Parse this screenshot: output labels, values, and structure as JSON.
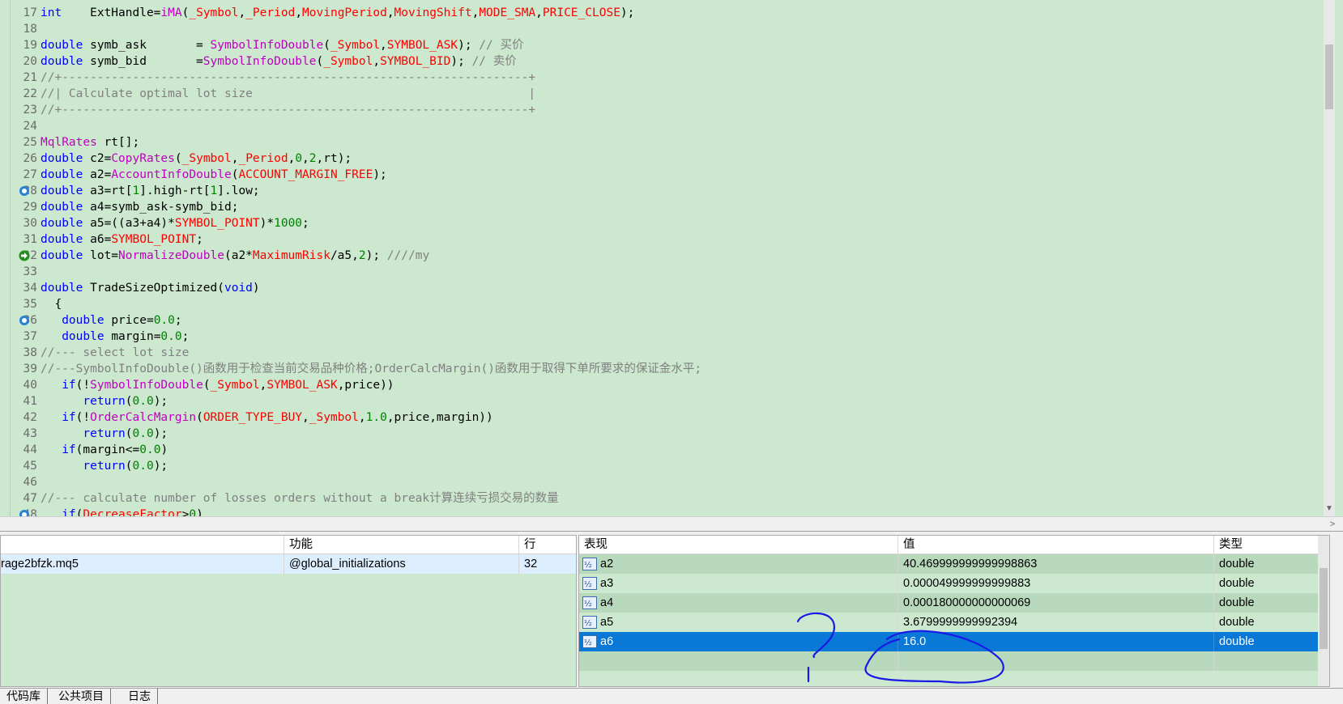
{
  "editor": {
    "lines": [
      {
        "n": "17",
        "marker": "",
        "tokens": [
          [
            "kw",
            "int    "
          ],
          [
            "id",
            "ExtHandle="
          ],
          [
            "fn",
            "iMA"
          ],
          [
            "id",
            "("
          ],
          [
            "cn",
            "_Symbol"
          ],
          [
            "id",
            ","
          ],
          [
            "cn",
            "_Period"
          ],
          [
            "id",
            ","
          ],
          [
            "cn",
            "MovingPeriod"
          ],
          [
            "id",
            ","
          ],
          [
            "cn",
            "MovingShift"
          ],
          [
            "id",
            ","
          ],
          [
            "cn",
            "MODE_SMA"
          ],
          [
            "id",
            ","
          ],
          [
            "cn",
            "PRICE_CLOSE"
          ],
          [
            "id",
            ");"
          ]
        ]
      },
      {
        "n": "18",
        "marker": "",
        "tokens": []
      },
      {
        "n": "19",
        "marker": "",
        "tokens": [
          [
            "kw",
            "double "
          ],
          [
            "id",
            "symb_ask       = "
          ],
          [
            "fn",
            "SymbolInfoDouble"
          ],
          [
            "id",
            "("
          ],
          [
            "cn",
            "_Symbol"
          ],
          [
            "id",
            ","
          ],
          [
            "cn",
            "SYMBOL_ASK"
          ],
          [
            "id",
            "); "
          ],
          [
            "cm",
            "// 买价"
          ]
        ]
      },
      {
        "n": "20",
        "marker": "",
        "tokens": [
          [
            "kw",
            "double "
          ],
          [
            "id",
            "symb_bid       ="
          ],
          [
            "fn",
            "SymbolInfoDouble"
          ],
          [
            "id",
            "("
          ],
          [
            "cn",
            "_Symbol"
          ],
          [
            "id",
            ","
          ],
          [
            "cn",
            "SYMBOL_BID"
          ],
          [
            "id",
            "); "
          ],
          [
            "cm",
            "// 卖价"
          ]
        ]
      },
      {
        "n": "21",
        "marker": "",
        "tokens": [
          [
            "cm",
            "//+------------------------------------------------------------------+"
          ]
        ]
      },
      {
        "n": "22",
        "marker": "",
        "tokens": [
          [
            "cm",
            "//| Calculate optimal lot size                                       |"
          ]
        ]
      },
      {
        "n": "23",
        "marker": "",
        "tokens": [
          [
            "cm",
            "//+------------------------------------------------------------------+"
          ]
        ]
      },
      {
        "n": "24",
        "marker": "",
        "tokens": []
      },
      {
        "n": "25",
        "marker": "",
        "tokens": [
          [
            "fn",
            "MqlRates"
          ],
          [
            "id",
            " rt[];"
          ]
        ]
      },
      {
        "n": "26",
        "marker": "",
        "tokens": [
          [
            "kw",
            "double "
          ],
          [
            "id",
            "c2="
          ],
          [
            "fn",
            "CopyRates"
          ],
          [
            "id",
            "("
          ],
          [
            "cn",
            "_Symbol"
          ],
          [
            "id",
            ","
          ],
          [
            "cn",
            "_Period"
          ],
          [
            "id",
            ","
          ],
          [
            "nm",
            "0"
          ],
          [
            "id",
            ","
          ],
          [
            "nm",
            "2"
          ],
          [
            "id",
            ",rt);"
          ]
        ]
      },
      {
        "n": "27",
        "marker": "",
        "tokens": [
          [
            "kw",
            "double "
          ],
          [
            "id",
            "a2="
          ],
          [
            "fn",
            "AccountInfoDouble"
          ],
          [
            "id",
            "("
          ],
          [
            "cn",
            "ACCOUNT_MARGIN_FREE"
          ],
          [
            "id",
            ");"
          ]
        ]
      },
      {
        "n": "28",
        "marker": "breakpoint",
        "tokens": [
          [
            "kw",
            "double "
          ],
          [
            "id",
            "a3=rt["
          ],
          [
            "nm",
            "1"
          ],
          [
            "id",
            "].high-rt["
          ],
          [
            "nm",
            "1"
          ],
          [
            "id",
            "].low;"
          ]
        ]
      },
      {
        "n": "29",
        "marker": "",
        "tokens": [
          [
            "kw",
            "double "
          ],
          [
            "id",
            "a4=symb_ask-symb_bid;"
          ]
        ]
      },
      {
        "n": "30",
        "marker": "",
        "tokens": [
          [
            "kw",
            "double "
          ],
          [
            "id",
            "a5=((a3+a4)*"
          ],
          [
            "cn",
            "SYMBOL_POINT"
          ],
          [
            "id",
            ")*"
          ],
          [
            "nm",
            "1000"
          ],
          [
            "id",
            ";"
          ]
        ]
      },
      {
        "n": "31",
        "marker": "",
        "tokens": [
          [
            "kw",
            "double "
          ],
          [
            "id",
            "a6="
          ],
          [
            "cn",
            "SYMBOL_POINT"
          ],
          [
            "id",
            ";"
          ]
        ]
      },
      {
        "n": "32",
        "marker": "current",
        "tokens": [
          [
            "kw",
            "double "
          ],
          [
            "id",
            "lot="
          ],
          [
            "fn",
            "NormalizeDouble"
          ],
          [
            "id",
            "(a2*"
          ],
          [
            "cn",
            "MaximumRisk"
          ],
          [
            "id",
            "/a5,"
          ],
          [
            "nm",
            "2"
          ],
          [
            "id",
            "); "
          ],
          [
            "cm",
            "////my"
          ]
        ]
      },
      {
        "n": "33",
        "marker": "",
        "tokens": []
      },
      {
        "n": "34",
        "marker": "",
        "tokens": [
          [
            "kw",
            "double "
          ],
          [
            "id",
            "TradeSizeOptimized("
          ],
          [
            "kw",
            "void"
          ],
          [
            "id",
            ")"
          ]
        ]
      },
      {
        "n": "35",
        "marker": "",
        "tokens": [
          [
            "id",
            "  {"
          ]
        ]
      },
      {
        "n": "36",
        "marker": "breakpoint",
        "tokens": [
          [
            "kw",
            "   double "
          ],
          [
            "id",
            "price="
          ],
          [
            "nm",
            "0.0"
          ],
          [
            "id",
            ";"
          ]
        ]
      },
      {
        "n": "37",
        "marker": "",
        "tokens": [
          [
            "kw",
            "   double "
          ],
          [
            "id",
            "margin="
          ],
          [
            "nm",
            "0.0"
          ],
          [
            "id",
            ";"
          ]
        ]
      },
      {
        "n": "38",
        "marker": "",
        "tokens": [
          [
            "cm",
            "//--- select lot size"
          ]
        ]
      },
      {
        "n": "39",
        "marker": "",
        "tokens": [
          [
            "cm",
            "//---SymbolInfoDouble()函数用于检查当前交易品种价格;OrderCalcMargin()函数用于取得下单所要求的保证金水平;"
          ]
        ]
      },
      {
        "n": "40",
        "marker": "",
        "tokens": [
          [
            "kw",
            "   if"
          ],
          [
            "id",
            "(!"
          ],
          [
            "fn",
            "SymbolInfoDouble"
          ],
          [
            "id",
            "("
          ],
          [
            "cn",
            "_Symbol"
          ],
          [
            "id",
            ","
          ],
          [
            "cn",
            "SYMBOL_ASK"
          ],
          [
            "id",
            ",price))"
          ]
        ]
      },
      {
        "n": "41",
        "marker": "",
        "tokens": [
          [
            "kw",
            "      return"
          ],
          [
            "id",
            "("
          ],
          [
            "nm",
            "0.0"
          ],
          [
            "id",
            ");"
          ]
        ]
      },
      {
        "n": "42",
        "marker": "",
        "tokens": [
          [
            "kw",
            "   if"
          ],
          [
            "id",
            "(!"
          ],
          [
            "fn",
            "OrderCalcMargin"
          ],
          [
            "id",
            "("
          ],
          [
            "cn",
            "ORDER_TYPE_BUY"
          ],
          [
            "id",
            ","
          ],
          [
            "cn",
            "_Symbol"
          ],
          [
            "id",
            ","
          ],
          [
            "nm",
            "1.0"
          ],
          [
            "id",
            ",price,margin))"
          ]
        ]
      },
      {
        "n": "43",
        "marker": "",
        "tokens": [
          [
            "kw",
            "      return"
          ],
          [
            "id",
            "("
          ],
          [
            "nm",
            "0.0"
          ],
          [
            "id",
            ");"
          ]
        ]
      },
      {
        "n": "44",
        "marker": "",
        "tokens": [
          [
            "kw",
            "   if"
          ],
          [
            "id",
            "(margin<="
          ],
          [
            "nm",
            "0.0"
          ],
          [
            "id",
            ")"
          ]
        ]
      },
      {
        "n": "45",
        "marker": "",
        "tokens": [
          [
            "kw",
            "      return"
          ],
          [
            "id",
            "("
          ],
          [
            "nm",
            "0.0"
          ],
          [
            "id",
            ");"
          ]
        ]
      },
      {
        "n": "46",
        "marker": "",
        "tokens": []
      },
      {
        "n": "47",
        "marker": "",
        "tokens": [
          [
            "cm",
            "//--- calculate number of losses orders without a break计算连续亏损交易的数量"
          ]
        ]
      },
      {
        "n": "48",
        "marker": "breakpoint",
        "tokens": [
          [
            "kw",
            "   if"
          ],
          [
            "id",
            "("
          ],
          [
            "cn",
            "DecreaseFactor"
          ],
          [
            "id",
            ">"
          ],
          [
            "nm",
            "0"
          ],
          [
            "id",
            ")"
          ]
        ]
      }
    ]
  },
  "callstack": {
    "headers": [
      "",
      "功能",
      "行"
    ],
    "rows": [
      {
        "file": "rage2bfzk.mq5",
        "function": "@global_initializations",
        "line": "32"
      }
    ]
  },
  "watch": {
    "headers": [
      "表现",
      "值",
      "类型"
    ],
    "rows": [
      {
        "name": "a2",
        "value": "40.469999999999998863",
        "type": "double"
      },
      {
        "name": "a3",
        "value": "0.000049999999999883",
        "type": "double"
      },
      {
        "name": "a4",
        "value": "0.000180000000000069",
        "type": "double"
      },
      {
        "name": "a5",
        "value": "3.6799999999992394",
        "type": "double"
      },
      {
        "name": "a6",
        "value": "16.0",
        "type": "double",
        "selected": true
      }
    ]
  },
  "tabs": [
    "代码库",
    "公共项目",
    "日志"
  ],
  "colors": {
    "editor_bg": "#cce8cf",
    "selection": "#0a78d7",
    "annotation": "#1a1ae6"
  }
}
